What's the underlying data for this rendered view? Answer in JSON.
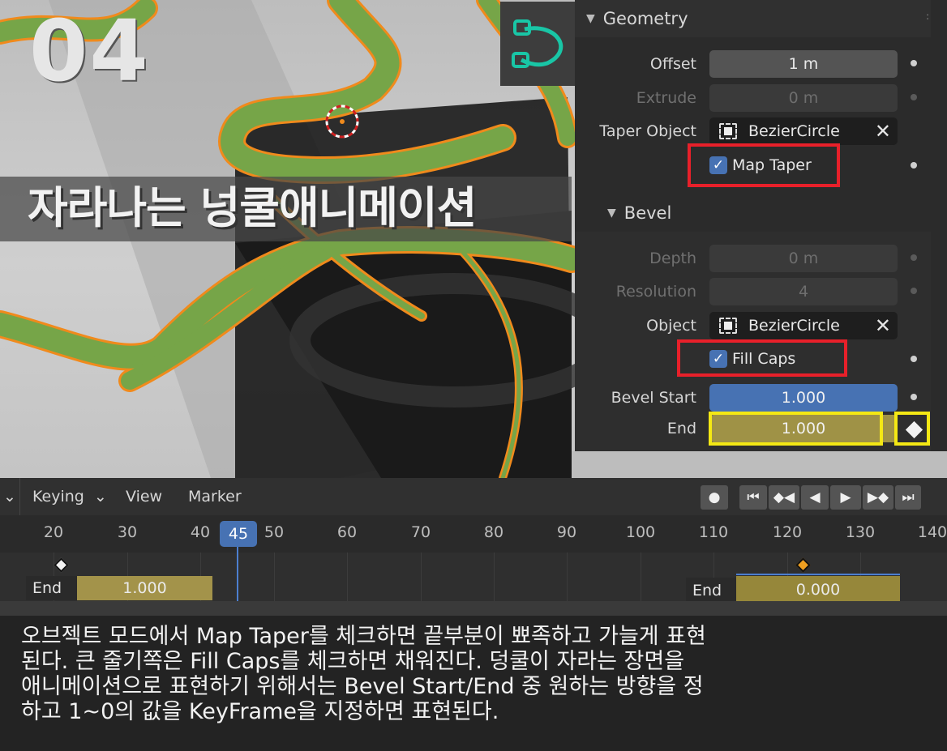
{
  "viewport": {
    "step_number": "04",
    "title": "자라나는 넝쿨애니메이션"
  },
  "properties": {
    "geometry_header": "Geometry",
    "offset": {
      "label": "Offset",
      "value": "1 m"
    },
    "extrude": {
      "label": "Extrude",
      "value": "0 m"
    },
    "taper_object": {
      "label": "Taper Object",
      "value": "BezierCircle"
    },
    "map_taper": {
      "label": "Map Taper",
      "checked": true
    },
    "bevel_header": "Bevel",
    "depth": {
      "label": "Depth",
      "value": "0 m"
    },
    "resolution": {
      "label": "Resolution",
      "value": "4"
    },
    "object": {
      "label": "Object",
      "value": "BezierCircle"
    },
    "fill_caps": {
      "label": "Fill Caps",
      "checked": true
    },
    "bevel_start": {
      "label": "Bevel Start",
      "value": "1.000"
    },
    "end": {
      "label": "End",
      "value": "1.000"
    },
    "colors": {
      "highlight_red": "#e8202a",
      "highlight_yellow": "#f4e814",
      "accent_blue": "#4772b3"
    }
  },
  "timeline": {
    "menus": {
      "keying": "Keying",
      "view": "View",
      "marker": "Marker"
    },
    "ticks": [
      "20",
      "30",
      "40",
      "50",
      "60",
      "70",
      "80",
      "90",
      "100",
      "110",
      "120",
      "130",
      "140"
    ],
    "current_frame": "45",
    "strip_left": {
      "label": "End",
      "value": "1.000"
    },
    "strip_right": {
      "label": "End",
      "value": "0.000"
    },
    "keyframe_colors": {
      "unselected": "#f2f2f2",
      "selected": "#f0a020"
    }
  },
  "caption": {
    "lines": [
      "오브젝트 모드에서 Map Taper를 체크하면 끝부분이 뾰족하고 가늘게 표현",
      "된다.  큰 줄기쪽은 Fill Caps를 체크하면 채워진다.  덩쿨이 자라는 장면을",
      "애니메이션으로 표현하기 위해서는 Bevel Start/End 중 원하는 방향을 정",
      "하고 1~0의 값을 KeyFrame을 지정하면 표현된다."
    ]
  }
}
